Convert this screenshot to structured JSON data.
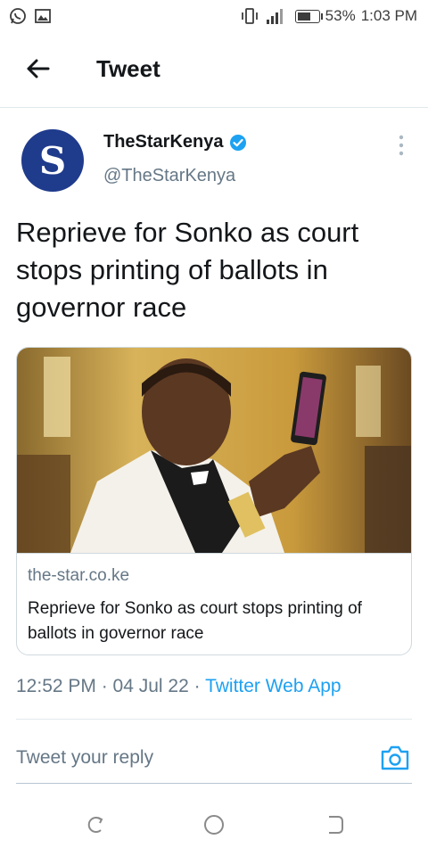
{
  "status_bar": {
    "battery": "53%",
    "time": "1:03 PM",
    "icons": [
      "whatsapp-icon",
      "gallery-icon",
      "vibrate-icon",
      "signal-icon",
      "battery-icon"
    ]
  },
  "header": {
    "back_icon": "arrow-left-icon",
    "title": "Tweet"
  },
  "tweet": {
    "avatar_letter": "S",
    "display_name": "TheStarKenya",
    "handle": "@TheStarKenya",
    "verified": true,
    "text": "Reprieve for Sonko as court stops printing of ballots in governor race",
    "timestamp": "12:52 PM · 04 Jul 22 · ",
    "source": "Twitter Web App"
  },
  "link_card": {
    "domain": "the-star.co.ke",
    "title": "Reprieve for Sonko as court stops printing of ballots in governor race",
    "image": "photo of man in white suit taking a selfie with phone"
  },
  "reply": {
    "placeholder": "Tweet your reply",
    "value": ""
  },
  "colors": {
    "accent": "#1da1f2",
    "text": "#14171a",
    "muted": "#657786",
    "avatar_bg": "#1f3b8c"
  },
  "nav": [
    "back-nav-icon",
    "home-nav-icon",
    "recents-nav-icon"
  ]
}
